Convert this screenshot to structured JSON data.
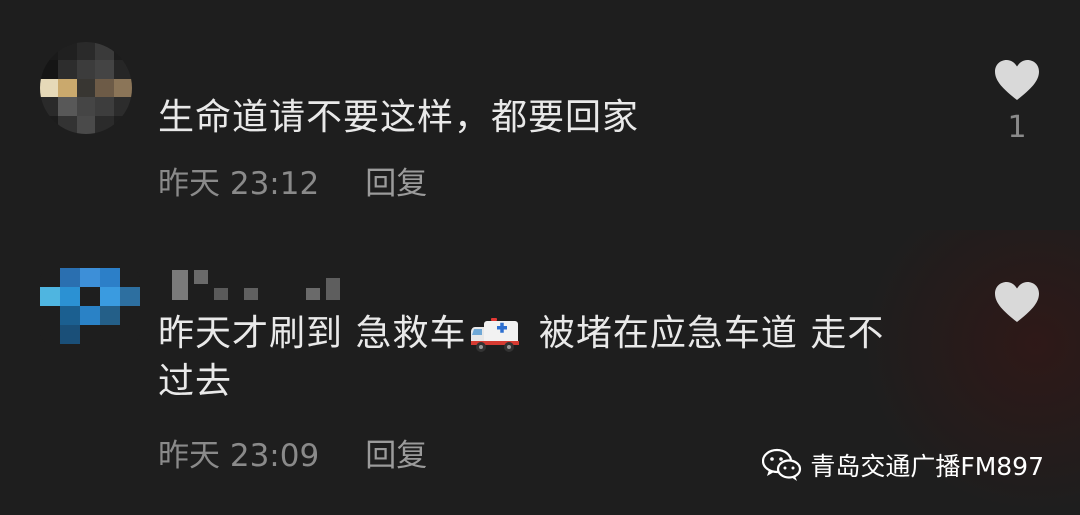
{
  "comments": [
    {
      "text": "生命道请不要这样，都要回家",
      "time": "昨天 23:12",
      "reply_label": "回复",
      "like_count": "1"
    },
    {
      "text_part1": "昨天才刷到 急救车",
      "text_part2": " 被堵在应急车道 走不",
      "text_line2": "过去",
      "time": "昨天 23:09",
      "reply_label": "回复",
      "like_count": ""
    }
  ],
  "watermark": {
    "text": "青岛交通广播FM897"
  },
  "icons": {
    "like": "heart-icon",
    "emoji": "ambulance-icon",
    "watermark": "wechat-icon"
  },
  "colors": {
    "background": "#1e1e1e",
    "text": "#e9e9e9",
    "muted": "#8a8a8a",
    "heart": "#d9d9d9"
  }
}
